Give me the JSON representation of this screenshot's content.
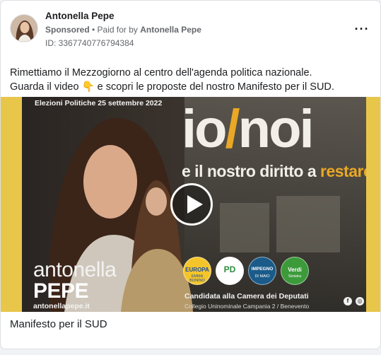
{
  "post": {
    "page_name": "Antonella Pepe",
    "sponsored_label": "Sponsored",
    "separator": " • ",
    "paid_for_prefix": "Paid for by ",
    "paid_for_by": "Antonella Pepe",
    "ad_id": "ID: 3367740776794384",
    "more_icon": "more-horizontal-icon",
    "body_lines": [
      "Rimettiamo il Mezzogiorno al centro dell'agenda politica nazionale.",
      "Guarda il video 👇 e scopri le proposte del nostro Manifesto per il SUD."
    ],
    "caption": "Manifesto per il SUD"
  },
  "video": {
    "play_icon": "play-icon",
    "poster_date": "Elezioni Politiche 25 settembre 2022",
    "poster_headline_left": "io",
    "poster_headline_slash": "/",
    "poster_headline_right": "noi",
    "poster_sub_main": "e il nostro diritto a ",
    "poster_sub_accent": "restare",
    "candidate_first": "antonella",
    "candidate_last": "PEPE",
    "website": "antonellapepe.it",
    "candidacy": "Candidata alla Camera dei Deputati",
    "college": "Collegio Uninominale Campania 2 / Benevento",
    "party_logos": [
      {
        "label": "EUROPA",
        "sub": "EMMA BONINO",
        "color": "#f4c52b"
      },
      {
        "label": "PD",
        "sub": "",
        "color": "#2e8b3e"
      },
      {
        "label": "IMPEGNO",
        "sub": "DI MAIO",
        "color": "#1a5b8a"
      },
      {
        "label": "Verdi",
        "sub": "Sinistra",
        "color": "#3c9a3a"
      }
    ],
    "social_icons": [
      "facebook-icon",
      "instagram-icon"
    ],
    "colors": {
      "accent": "#e9a825",
      "frame": "#e8c64a"
    }
  }
}
